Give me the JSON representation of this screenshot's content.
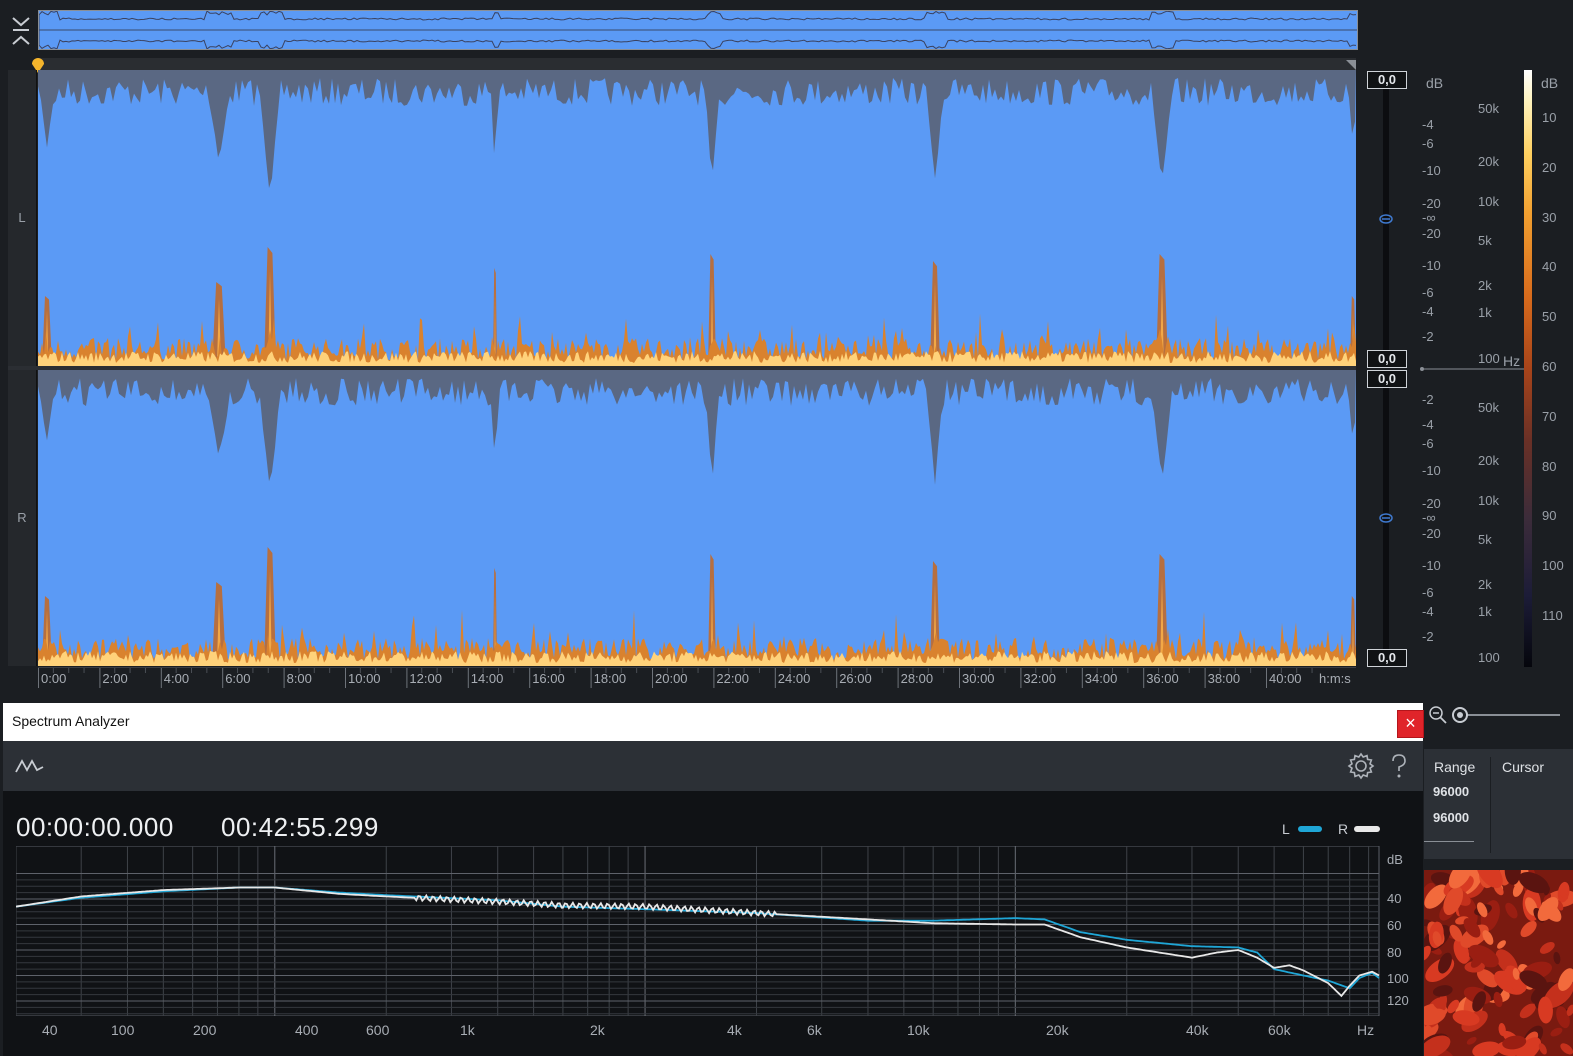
{
  "channels": {
    "left_label": "L",
    "right_label": "R"
  },
  "amplitude_readouts": [
    "0,0",
    "0,0",
    "0,0",
    "0,0"
  ],
  "db_scale_top": {
    "unit": "dB",
    "ticks": [
      "-4",
      "-6",
      "-10",
      "-20",
      "-∞",
      "-20",
      "-10",
      "-6",
      "-4",
      "-2"
    ]
  },
  "db_scale_bottom": {
    "ticks": [
      "-2",
      "-4",
      "-6",
      "-10",
      "-20",
      "-∞",
      "-20",
      "-10",
      "-6",
      "-4",
      "-2"
    ]
  },
  "freq_scale_top": {
    "ticks": [
      "50k",
      "20k",
      "10k",
      "5k",
      "2k",
      "1k",
      "100"
    ],
    "unit": "Hz"
  },
  "freq_scale_bottom": {
    "ticks": [
      "50k",
      "20k",
      "10k",
      "5k",
      "2k",
      "1k",
      "100"
    ]
  },
  "colorbar": {
    "unit": "dB",
    "ticks": [
      "10",
      "20",
      "30",
      "40",
      "50",
      "60",
      "70",
      "80",
      "90",
      "100",
      "110"
    ]
  },
  "time_ruler": {
    "ticks": [
      "0:00",
      "2:00",
      "4:00",
      "6:00",
      "8:00",
      "10:00",
      "12:00",
      "14:00",
      "16:00",
      "18:00",
      "20:00",
      "22:00",
      "24:00",
      "26:00",
      "28:00",
      "30:00",
      "32:00",
      "34:00",
      "36:00",
      "38:00",
      "40:00"
    ],
    "unit": "h:m:s"
  },
  "spectrum_analyzer": {
    "title": "Spectrum Analyzer",
    "close_label": "×",
    "time_start": "00:00:00.000",
    "time_end": "00:42:55.299",
    "legend": [
      {
        "name": "L",
        "color": "#1fa6d6"
      },
      {
        "name": "R",
        "color": "#e8e8e8"
      }
    ],
    "db_axis": [
      "dB",
      "40",
      "60",
      "80",
      "100",
      "120"
    ],
    "freq_axis": [
      "40",
      "100",
      "200",
      "400",
      "600",
      "1k",
      "2k",
      "4k",
      "6k",
      "10k",
      "20k",
      "40k",
      "60k",
      "Hz"
    ]
  },
  "info_panel": {
    "headers": [
      "Range",
      "Cursor"
    ],
    "values": [
      "96000",
      "96000"
    ]
  },
  "icons": {
    "collapse": "collapse-icon",
    "spectrum": "spectrum-icon",
    "settings": "gear-icon",
    "help": "help-icon",
    "zoom": "zoom-out-icon",
    "close": "close-icon"
  },
  "colors": {
    "waveform": "#5b9af5",
    "accent": "#f5b52c",
    "close": "#e0242a"
  }
}
